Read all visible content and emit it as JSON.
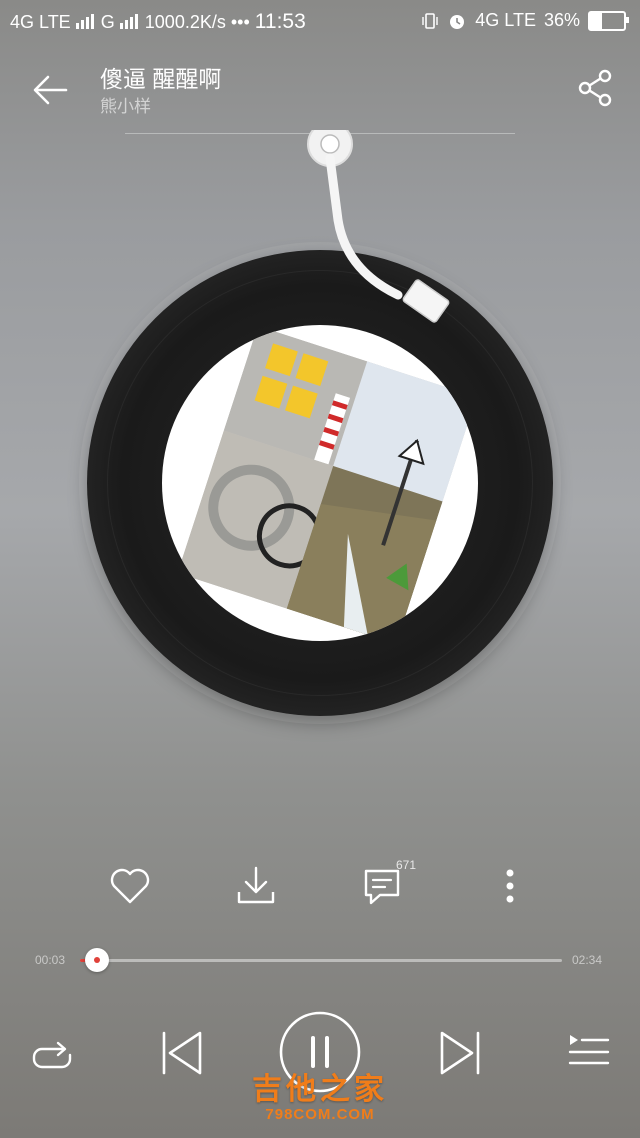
{
  "status_bar": {
    "network1": "4G LTE",
    "network2": "G",
    "speed": "1000.2K/s",
    "dots": "•••",
    "time": "11:53",
    "network3": "4G LTE",
    "battery": "36%",
    "battery_level": 0.36
  },
  "header": {
    "title": "傻逼 醒醒啊",
    "artist": "熊小样"
  },
  "actions": {
    "comment_count": "671"
  },
  "player": {
    "current_time": "00:03",
    "total_time": "02:34",
    "progress": 0.02,
    "state": "playing"
  },
  "watermark": {
    "cn": "吉他之家",
    "en": "798COM.COM"
  },
  "colors": {
    "accent": "#e0413a",
    "watermark": "#f07d1a"
  },
  "icons": [
    "back-arrow-icon",
    "share-icon",
    "heart-icon",
    "download-icon",
    "comment-icon",
    "more-icon",
    "repeat-icon",
    "previous-icon",
    "pause-icon",
    "next-icon",
    "playlist-icon"
  ]
}
